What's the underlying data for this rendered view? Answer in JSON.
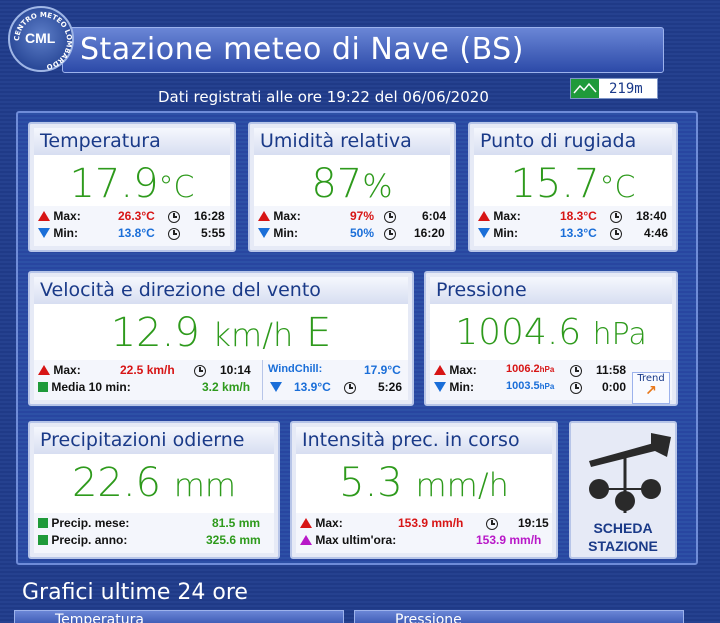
{
  "header": {
    "logo_text": "CML",
    "logo_ring_text": "CENTRO METEO LOMBARDO",
    "title": "Stazione meteo di Nave (BS)",
    "subtitle": "Dati registrati alle ore 19:22 del 06/06/2020",
    "altitude": "219m"
  },
  "temperatura": {
    "title": "Temperatura",
    "value": "17.9",
    "unit": "°C",
    "max_label": "Max:",
    "max_value": "26.3°C",
    "max_time": "16:28",
    "min_label": "Min:",
    "min_value": "13.8°C",
    "min_time": "5:55"
  },
  "umidita": {
    "title": "Umidità relativa",
    "value": "87",
    "unit": "%",
    "max_label": "Max:",
    "max_value": "97%",
    "max_time": "6:04",
    "min_label": "Min:",
    "min_value": "50%",
    "min_time": "16:20"
  },
  "rugiada": {
    "title": "Punto di rugiada",
    "value": "15.7",
    "unit": "°C",
    "max_label": "Max:",
    "max_value": "18.3°C",
    "max_time": "18:40",
    "min_label": "Min:",
    "min_value": "13.3°C",
    "min_time": "4:46"
  },
  "vento": {
    "title": "Velocità e direzione del vento",
    "value": "12.9",
    "unit": "km/h",
    "direction": "E",
    "max_label": "Max:",
    "max_value": "22.5 km/h",
    "max_time": "10:14",
    "media_label": "Media 10 min:",
    "media_value": "3.2 km/h",
    "windchill_label": "WindChill:",
    "windchill_value": "17.9°C",
    "windchill_min_value": "13.9°C",
    "windchill_min_time": "5:26"
  },
  "pressione": {
    "title": "Pressione",
    "value": "1004.6",
    "unit": "hPa",
    "max_label": "Max:",
    "max_value": "1006.2",
    "max_unit": "hPa",
    "max_time": "11:58",
    "min_label": "Min:",
    "min_value": "1003.5",
    "min_unit": "hPa",
    "min_time": "0:00",
    "trend_label": "Trend"
  },
  "precipitazioni": {
    "title": "Precipitazioni odierne",
    "value": "22.6",
    "unit": "mm",
    "mese_label": "Precip. mese:",
    "mese_value": "81.5 mm",
    "anno_label": "Precip. anno:",
    "anno_value": "325.6 mm"
  },
  "intensita": {
    "title": "Intensità prec. in corso",
    "value": "5.3",
    "unit": "mm/h",
    "max_label": "Max:",
    "max_value": "153.9 mm/h",
    "max_time": "19:15",
    "maxora_label": "Max ultim'ora:",
    "maxora_value": "153.9 mm/h"
  },
  "scheda": {
    "line1": "SCHEDA",
    "line2": "STAZIONE"
  },
  "grafici": {
    "title": "Grafici ultime 24 ore",
    "tab1": "Temperatura",
    "tab2": "Pressione"
  },
  "colors": {
    "value_green": "#2e9a1c",
    "max_red": "#d71515",
    "min_blue": "#1a6ed8",
    "accent_blue": "#1a3a88"
  }
}
